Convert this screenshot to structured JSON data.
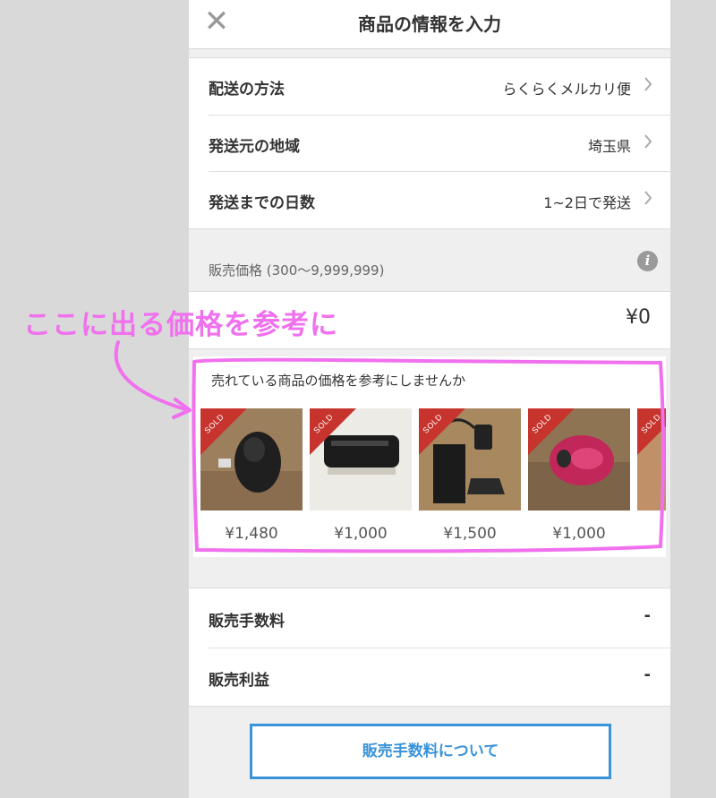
{
  "header": {
    "title": "商品の情報を入力",
    "close_icon": "close-icon"
  },
  "shipping": [
    {
      "label": "配送の方法",
      "value": "らくらくメルカリ便"
    },
    {
      "label": "発送元の地域",
      "value": "埼玉県"
    },
    {
      "label": "発送までの日数",
      "value": "1~2日で発送"
    }
  ],
  "price": {
    "label": "販売価格 (300〜9,999,999)",
    "value": "¥0",
    "info_icon": "i"
  },
  "reference": {
    "title": "売れている商品の価格を参考にしませんか",
    "badge": "SOLD",
    "items": [
      {
        "price": "¥1,480",
        "image": "black wireless mouse on wood table"
      },
      {
        "price": "¥1,000",
        "image": "black router on white surface"
      },
      {
        "price": "¥1,500",
        "image": "black device with adapter and cables"
      },
      {
        "price": "¥1,000",
        "image": "red wireless mouse on wood table"
      }
    ]
  },
  "fees": [
    {
      "label": "販売手数料",
      "value": "-"
    },
    {
      "label": "販売利益",
      "value": "-"
    }
  ],
  "about_button": "販売手数料について",
  "annotation": {
    "text": "ここに出る価格を参考に",
    "color": "#f070ee"
  },
  "colors": {
    "accent": "#3a93d8",
    "sold": "#c7342e"
  }
}
